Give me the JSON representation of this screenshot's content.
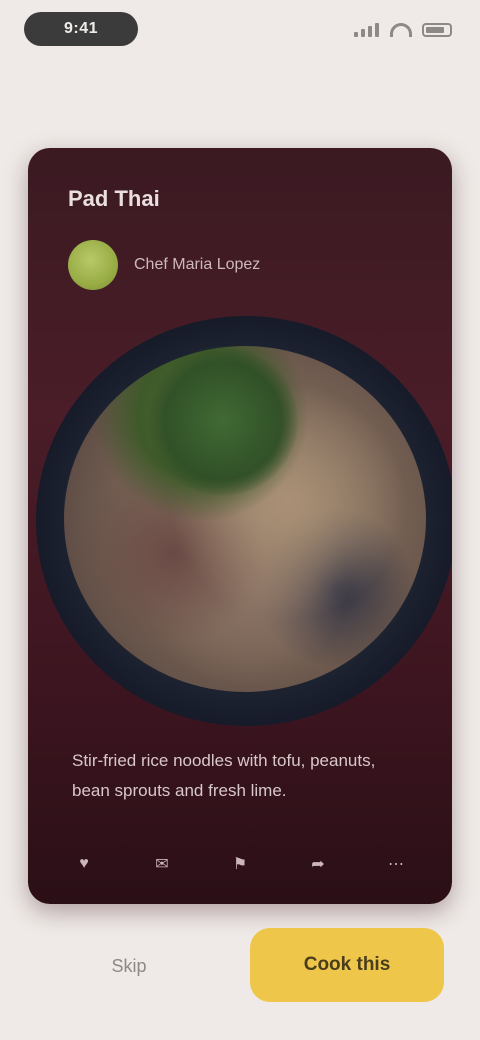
{
  "status_bar": {
    "time": "9:41",
    "icons": [
      "cellular-signal-icon",
      "wifi-icon",
      "battery-icon"
    ]
  },
  "recipe_card": {
    "title": "Pad Thai",
    "author": {
      "name": "Chef Maria Lopez"
    },
    "image": "bowl-of-noodles-with-herbs",
    "description": "Stir-fried rice noodles with tofu, peanuts, bean sprouts and fresh lime.",
    "actions": [
      "heart-icon",
      "comment-icon",
      "bookmark-icon",
      "share-icon",
      "more-icon"
    ]
  },
  "bottom_actions": {
    "skip_label": "Skip",
    "primary_label": "Cook this"
  },
  "colors": {
    "background": "#efeae7",
    "card": "#4a1d28",
    "accent": "#eec74a",
    "avatar": "#98ad45"
  }
}
